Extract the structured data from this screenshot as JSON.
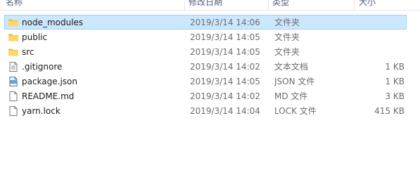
{
  "columns": {
    "name": "名称",
    "date": "修改日期",
    "type": "类型",
    "size": "大小"
  },
  "files": [
    {
      "name": "node_modules",
      "date": "2019/3/14 14:06",
      "type": "文件夹",
      "size": "",
      "icon": "folder-icon",
      "selected": true
    },
    {
      "name": "public",
      "date": "2019/3/14 14:05",
      "type": "文件夹",
      "size": "",
      "icon": "folder-icon",
      "selected": false
    },
    {
      "name": "src",
      "date": "2019/3/14 14:05",
      "type": "文件夹",
      "size": "",
      "icon": "folder-icon",
      "selected": false
    },
    {
      "name": ".gitignore",
      "date": "2019/3/14 14:02",
      "type": "文本文档",
      "size": "1 KB",
      "icon": "text-document-icon",
      "selected": false
    },
    {
      "name": "package.json",
      "date": "2019/3/14 14:05",
      "type": "JSON 文件",
      "size": "1 KB",
      "icon": "json-file-icon",
      "selected": false
    },
    {
      "name": "README.md",
      "date": "2019/3/14 14:02",
      "type": "MD 文件",
      "size": "3 KB",
      "icon": "file-icon",
      "selected": false
    },
    {
      "name": "yarn.lock",
      "date": "2019/3/14 14:04",
      "type": "LOCK 文件",
      "size": "415 KB",
      "icon": "file-icon",
      "selected": false
    }
  ],
  "colors": {
    "selection_background": "#cce8ff",
    "selection_border": "#99d1ff",
    "folder": "#ffd766",
    "header_text": "#4c607a"
  }
}
